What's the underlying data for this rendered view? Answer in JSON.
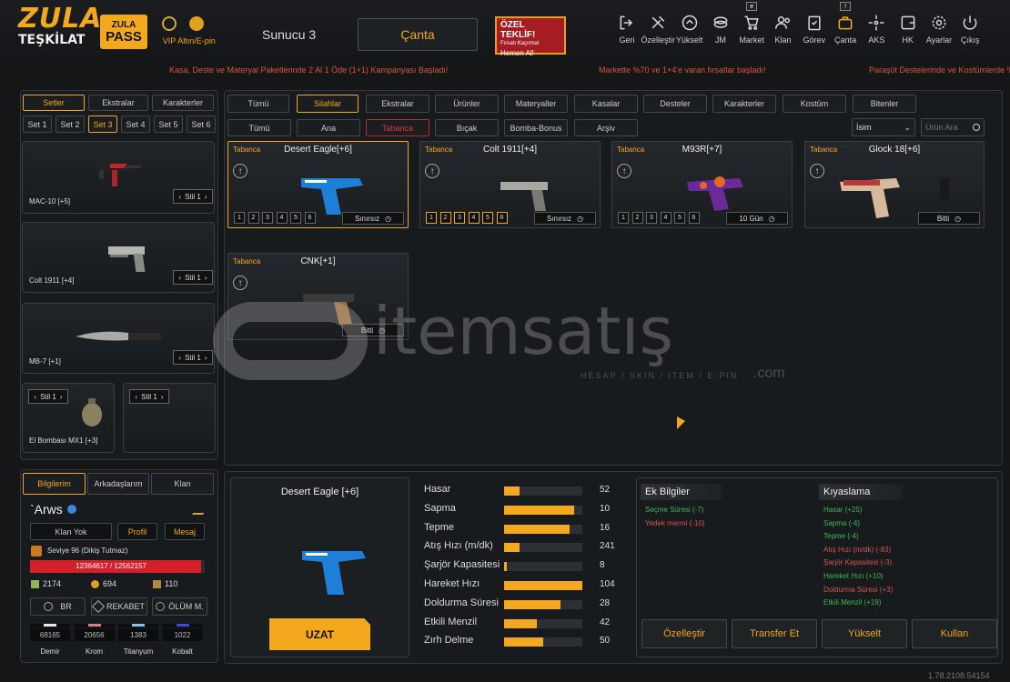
{
  "logo": {
    "line1": "ZULA",
    "line2": "TEŞKİLAT"
  },
  "pass": {
    "line1": "ZULA",
    "line2": "PASS"
  },
  "vip": {
    "label": "VIP"
  },
  "gold": {
    "label": "Altın/E-pin"
  },
  "server": "Sunucu 3",
  "page_title": "Çanta",
  "offer": {
    "title": "ÖZEL TEKLİF!",
    "subtitle": "Fırsatı Kaçırma!",
    "cta": "Hemen Al!"
  },
  "nav": [
    {
      "label": "Geri",
      "icon": "exit-icon"
    },
    {
      "label": "Özelleştir",
      "icon": "tools-icon"
    },
    {
      "label": "Yükselt",
      "icon": "chevron-up-icon"
    },
    {
      "label": "JM",
      "icon": "coins-icon"
    },
    {
      "label": "Market",
      "icon": "cart-icon",
      "badge": "e"
    },
    {
      "label": "Klan",
      "icon": "users-icon"
    },
    {
      "label": "Görev",
      "icon": "clipboard-icon"
    },
    {
      "label": "Çanta",
      "icon": "bag-icon",
      "badge": "!"
    },
    {
      "label": "AKS",
      "icon": "crosshair-icon"
    },
    {
      "label": "HK",
      "icon": "wallet-icon"
    },
    {
      "label": "Ayarlar",
      "icon": "gear-icon"
    },
    {
      "label": "Çıkış",
      "icon": "power-icon"
    }
  ],
  "ticker": [
    "Kasa, Deste ve Materyal Paketlerinde 2 Al 1 Öde (1+1) Kampanyası Başladı!",
    "Markette %70 ve 1+4'e varan fırsatlar başladı!",
    "Paraşüt Destelerinde ve Kostümlerde %50"
  ],
  "left_tabs": [
    "Setler",
    "Ekstralar",
    "Karakterler"
  ],
  "set_tabs": [
    "Set 1",
    "Set 2",
    "Set 3",
    "Set 4",
    "Set 5",
    "Set 6"
  ],
  "loadout": [
    {
      "label": "MAC-10 [+5]",
      "style": "Stil 1"
    },
    {
      "label": "Colt 1911 [+4]",
      "style": "Stil 1"
    },
    {
      "label": "MB-7 [+1]",
      "style": "Stil 1"
    },
    {
      "label": "El Bombası MX1 [+3]",
      "style": "Stil 1"
    },
    {
      "label": "",
      "style": "Stil 1"
    }
  ],
  "profile_tabs": [
    "Bilgilerim",
    "Arkadaşlarım",
    "Klan"
  ],
  "player": {
    "name": "`Arws",
    "clan_btn": "Klan Yok",
    "profile_btn": "Profil",
    "message_btn": "Mesaj",
    "level": "Seviye 96 (Dikiş Tutmaz)",
    "xp": "12364617 / 12562157",
    "xp_fill": 0.98,
    "stat1": "2174",
    "stat2": "694",
    "stat3": "110",
    "modes": [
      "BR",
      "REKABET",
      "ÖLÜM M."
    ],
    "resources": [
      {
        "value": "68165",
        "label": "Demir",
        "color": "#e8e8e8"
      },
      {
        "value": "20656",
        "label": "Krom",
        "color": "#d98080"
      },
      {
        "value": "1383",
        "label": "Titanyum",
        "color": "#8cc4e8"
      },
      {
        "value": "1022",
        "label": "Kobalt",
        "color": "#3c4ad0"
      }
    ]
  },
  "category_tabs": [
    "Tümü",
    "Silahlar",
    "Ekstralar",
    "Ürünler",
    "Materyaller",
    "Kasalar",
    "Desteler",
    "Karakterler",
    "Kostüm",
    "Bitenler"
  ],
  "sub_tabs": [
    "Tümü",
    "Ana",
    "Tabanca",
    "Bıçak",
    "Bomba-Bonus",
    "Arşiv"
  ],
  "sort": {
    "value": "İsim"
  },
  "search": {
    "placeholder": "Ürün Ara"
  },
  "items": [
    {
      "cat": "Tabanca",
      "name": "Desert Eagle[+6]",
      "levels": [
        "1",
        "2",
        "3",
        "4",
        "5",
        "6"
      ],
      "active_levels": 0,
      "duration": "Sınırsız"
    },
    {
      "cat": "Tabanca",
      "name": "Colt 1911[+4]",
      "levels": [
        "1",
        "2",
        "3",
        "4",
        "5",
        "6"
      ],
      "active_levels": 6,
      "duration": "Sınırsız"
    },
    {
      "cat": "Tabanca",
      "name": "M93R[+7]",
      "levels": [
        "1",
        "2",
        "3",
        "4",
        "5",
        "6"
      ],
      "active_levels": 0,
      "duration": "10 Gün"
    },
    {
      "cat": "Tabanca",
      "name": "Glock 18[+6]",
      "levels": [],
      "active_levels": 0,
      "duration": "Bitti"
    },
    {
      "cat": "Tabanca",
      "name": "CNK[+1]",
      "levels": [],
      "active_levels": 0,
      "duration": "Bitti"
    }
  ],
  "watermark": {
    "brand": "itemsatış",
    "sub": "HESAP / SKIN / ITEM / E-PIN",
    "tld": ".com"
  },
  "detail": {
    "name": "Desert Eagle [+6]",
    "extend_btn": "UZAT"
  },
  "stats": [
    {
      "label": "Hasar",
      "value": "52",
      "fill": 0.2
    },
    {
      "label": "Sapma",
      "value": "10",
      "fill": 0.9
    },
    {
      "label": "Tepme",
      "value": "16",
      "fill": 0.84
    },
    {
      "label": "Atış Hızı (m/dk)",
      "value": "241",
      "fill": 0.2
    },
    {
      "label": "Şarjör Kapasitesi",
      "value": "8",
      "fill": 0.04
    },
    {
      "label": "Hareket Hızı",
      "value": "104",
      "fill": 1.0
    },
    {
      "label": "Doldurma Süresi",
      "value": "28",
      "fill": 0.72
    },
    {
      "label": "Etkili Menzil",
      "value": "42",
      "fill": 0.42
    },
    {
      "label": "Zırh Delme",
      "value": "50",
      "fill": 0.5
    }
  ],
  "extra": {
    "title": "Ek Bilgiler",
    "lines": [
      {
        "text": "Seçme Süresi (-7)",
        "good": true
      },
      {
        "text": "Yedek mermi (-10)",
        "good": false
      }
    ]
  },
  "compare": {
    "title": "Kıyaslama",
    "lines": [
      {
        "text": "Hasar (+25)",
        "good": true
      },
      {
        "text": "Sapma (-4)",
        "good": true
      },
      {
        "text": "Tepme (-4)",
        "good": true
      },
      {
        "text": "Atış Hızı (m/dk) (-83)",
        "good": false
      },
      {
        "text": "Şarjör Kapasitesi (-3)",
        "good": false
      },
      {
        "text": "Hareket Hızı (+10)",
        "good": true
      },
      {
        "text": "Doldurma Süresi (+3)",
        "good": false
      },
      {
        "text": "Etkili Menzil (+19)",
        "good": true
      }
    ]
  },
  "actions": [
    "Özelleştir",
    "Transfer Et",
    "Yükselt",
    "Kullan"
  ],
  "version": "1.78.2108.54154"
}
